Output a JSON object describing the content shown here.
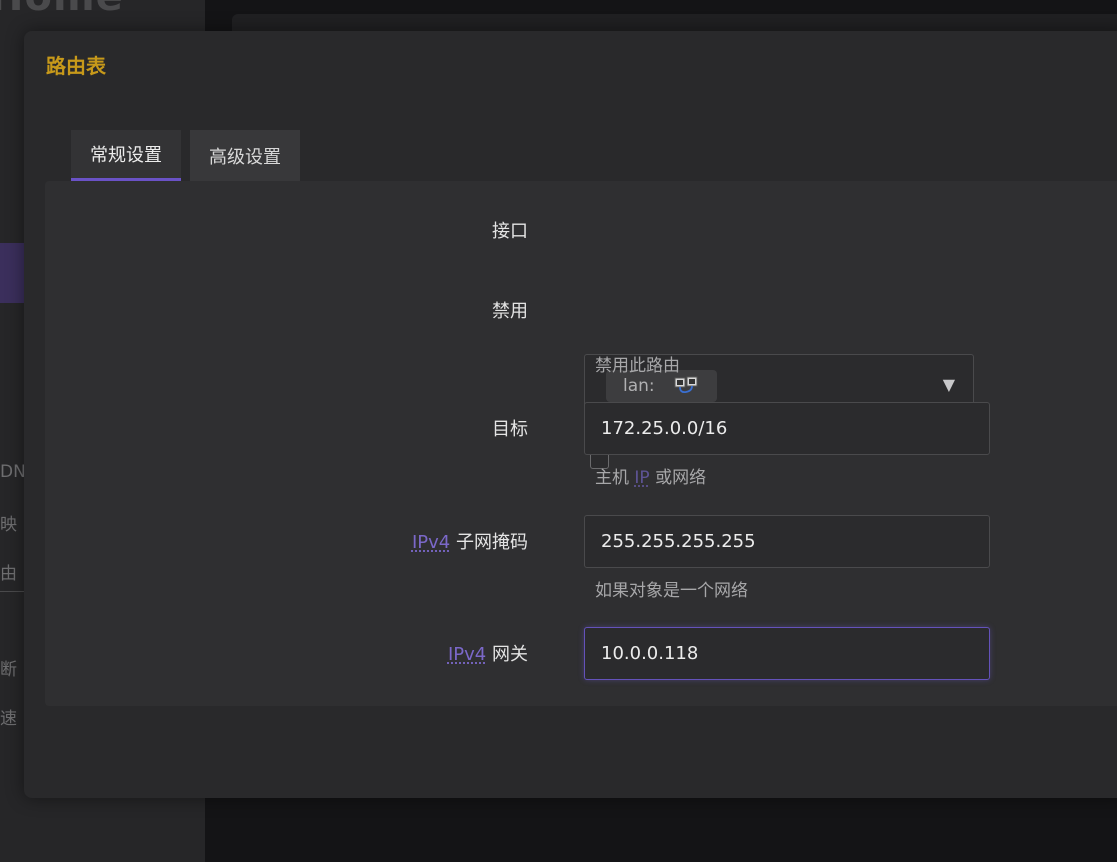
{
  "background": {
    "logo_text": "Home",
    "sidebar_fragments": [
      "DN",
      "映",
      "由",
      "断",
      "速"
    ]
  },
  "modal": {
    "title": "路由表",
    "tabs": [
      {
        "label": "常规设置",
        "active": true
      },
      {
        "label": "高级设置",
        "active": false
      }
    ]
  },
  "form": {
    "interface": {
      "label": "接口",
      "chip_text": "lan:",
      "chip_icon": "network-ports-icon",
      "caret": "▼"
    },
    "disable": {
      "label": "禁用",
      "checked": false,
      "help": "禁用此路由"
    },
    "target": {
      "label": "目标",
      "value": "172.25.0.0/16",
      "help_prefix": "主机",
      "help_abbr": "IP",
      "help_suffix": "或网络"
    },
    "netmask": {
      "label_abbr": "IPv4",
      "label_suffix": "子网掩码",
      "value": "255.255.255.255",
      "help": "如果对象是一个网络"
    },
    "gateway": {
      "label_abbr": "IPv4",
      "label_suffix": "网关",
      "value": "10.0.0.118"
    }
  },
  "colors": {
    "accent": "#6a52c6",
    "title": "#c7991a"
  }
}
